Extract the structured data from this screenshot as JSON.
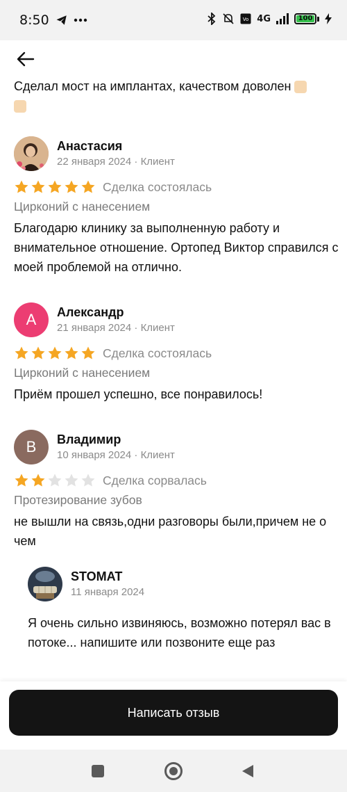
{
  "status_bar": {
    "time": "8:50",
    "network": "4G",
    "battery": "100",
    "icons": [
      "telegram-icon",
      "more-dots-icon",
      "bluetooth-icon",
      "mute-icon",
      "volte-icon",
      "signal-icon",
      "battery-icon",
      "charging-icon"
    ]
  },
  "header": {
    "back_icon": "arrow-left-icon"
  },
  "partial_review": {
    "text": "Сделал мост на имплантах, качеством доволен"
  },
  "reviews": [
    {
      "name": "Анастасия",
      "date": "22 января 2024 · Клиент",
      "rating": 5,
      "deal": "Сделка состоялась",
      "service": "Цирконий с нанесением",
      "text": "Благодарю клинику за выполненную работу и внимательное отношение. Ортопед Виктор справился с моей проблемой на отлично.",
      "avatar_type": "photo"
    },
    {
      "name": "Александр",
      "date": "21 января 2024 · Клиент",
      "rating": 5,
      "deal": "Сделка состоялась",
      "service": "Цирконий с нанесением",
      "text": "Приём прошел успешно, все понравилось!",
      "avatar_letter": "А",
      "avatar_color": "#ec3d72"
    },
    {
      "name": "Владимир",
      "date": "10 января 2024 · Клиент",
      "rating": 2,
      "deal": "Сделка сорвалась",
      "service": "Протезирование зубов",
      "text": "не вышли на связь,одни разговоры были,причем не о чем",
      "avatar_letter": "В",
      "avatar_color": "#8a6a5f",
      "reply": {
        "name": "STOMAT",
        "date": "11 января 2024",
        "text": "Я очень сильно извиняюсь, возможно потерял вас в потоке... напишите или позвоните еще раз"
      }
    }
  ],
  "colors": {
    "star_filled": "#f5a623",
    "star_empty": "#e2e2e2",
    "button_bg": "#141414"
  },
  "write_button": {
    "label": "Написать отзыв"
  },
  "nav": {
    "square_icon": "recents-square-icon",
    "home_icon": "home-circle-icon",
    "back_icon": "back-triangle-icon"
  }
}
